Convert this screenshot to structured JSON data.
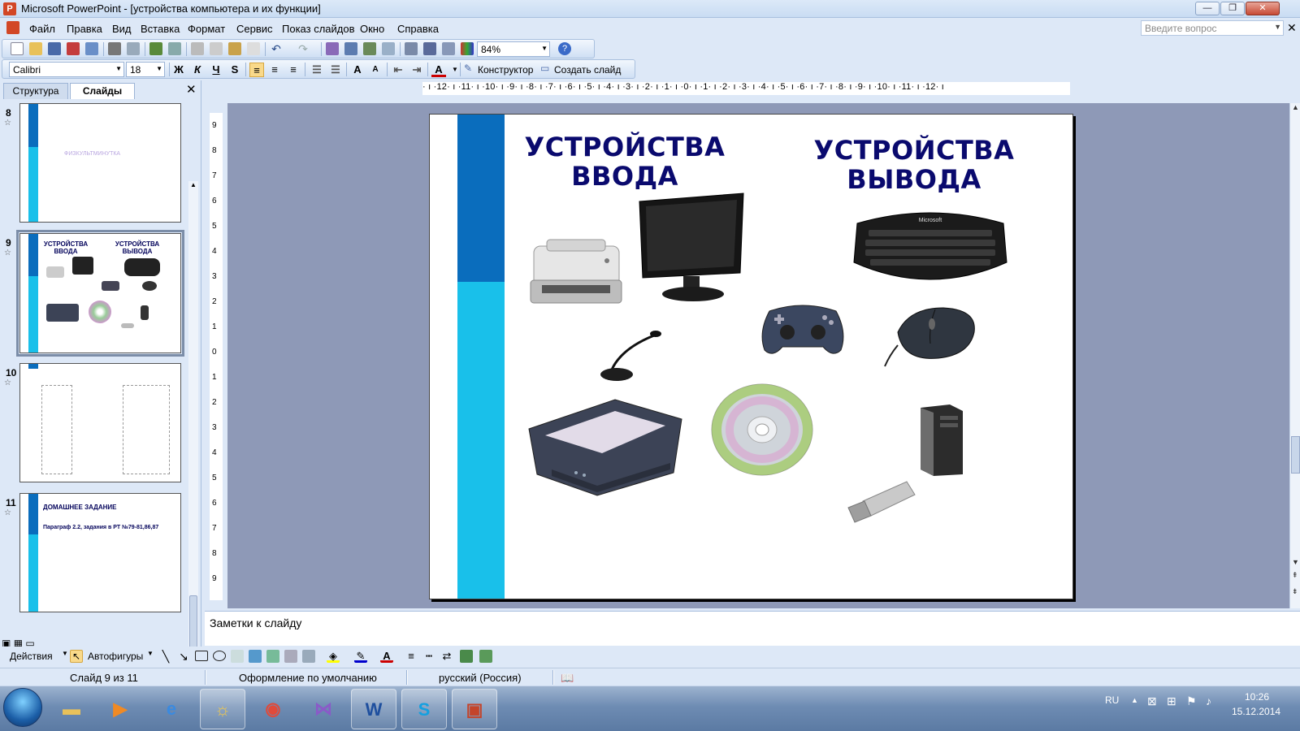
{
  "window": {
    "title": "Microsoft PowerPoint - [устройства компьютера и их функции]",
    "min": "—",
    "max": "❐",
    "close": "✕"
  },
  "menu": {
    "items": [
      "Файл",
      "Правка",
      "Вид",
      "Вставка",
      "Формат",
      "Сервис",
      "Показ слайдов",
      "Окно",
      "Справка"
    ],
    "help_placeholder": "Введите вопрос",
    "close": "✕"
  },
  "toolbar_standard": {
    "zoom": "84%"
  },
  "toolbar_format": {
    "font": "Calibri",
    "size": "18",
    "bold": "Ж",
    "italic": "К",
    "underline": "Ч",
    "shadow": "S",
    "designer": "Конструктор",
    "new_slide": "Создать слайд"
  },
  "left_pane": {
    "tabs": [
      "Структура",
      "Слайды"
    ],
    "close": "✕",
    "slides": [
      {
        "number": "8",
        "text": "ФИЗКУЛЬТМИНУТКА"
      },
      {
        "number": "9",
        "title_left": "УСТРОЙСТВА ВВОДА",
        "title_right": "УСТРОЙСТВА ВЫВОДА"
      },
      {
        "number": "10"
      },
      {
        "number": "11",
        "title": "ДОМАШНЕЕ ЗАДАНИЕ",
        "text": "Параграф 2.2, задания в РТ №79-81,86,87"
      }
    ]
  },
  "ruler": {
    "h": "· ı ·12· ı ·11· ı ·10· ı ·9· ı ·8· ı ·7· ı ·6· ı ·5· ı ·4· ı ·3· ı ·2· ı ·1· ı ·0· ı ·1· ı ·2· ı ·3· ı ·4· ı ·5· ı ·6· ı ·7· ı ·8· ı ·9· ı ·10· ı ·11· ı ·12· ı",
    "v": [
      "9",
      "8",
      "7",
      "6",
      "5",
      "4",
      "3",
      "2",
      "1",
      "0",
      "1",
      "2",
      "3",
      "4",
      "5",
      "6",
      "7",
      "8",
      "9"
    ]
  },
  "slide": {
    "title_left": "УСТРОЙСТВА ВВОДА",
    "title_right": "УСТРОЙСТВА ВЫВОДА",
    "images": [
      "printer",
      "monitor",
      "keyboard",
      "microphone",
      "gamepad",
      "mouse",
      "scanner",
      "cd-disc",
      "system-unit",
      "usb-flash-drive"
    ],
    "colors": {
      "dark_bar": "#0a6dbd",
      "light_bar": "#19c0ea",
      "title": "#0a0a6e"
    }
  },
  "notes": {
    "placeholder": "Заметки к слайду"
  },
  "drawing_toolbar": {
    "actions": "Действия",
    "autoshapes": "Автофигуры"
  },
  "status": {
    "slide": "Слайд 9 из 11",
    "design": "Оформление по умолчанию",
    "language": "русский (Россия)"
  },
  "taskbar": {
    "apps": [
      "explorer",
      "media-player",
      "internet-explorer",
      "unknown-app",
      "chrome",
      "visual-studio",
      "word",
      "skype",
      "powerpoint"
    ],
    "lang": "RU",
    "time": "10:26",
    "date": "15.12.2014"
  }
}
